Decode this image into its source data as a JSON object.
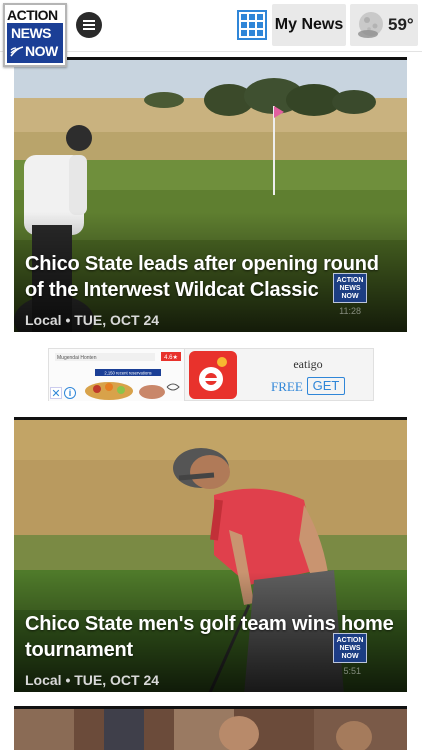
{
  "header": {
    "logo": {
      "line1": "ACTION",
      "line2": "NEWS",
      "line3": "NOW"
    },
    "menu_icon": "hamburger-menu-icon",
    "grid_icon": "grid-view-icon",
    "my_news_label": "My News",
    "weather": {
      "icon": "moon-cloud-icon",
      "temperature": "59°"
    }
  },
  "stories": [
    {
      "title": "Chico State leads after opening round of the Interwest Wildcat Classic",
      "meta": "Local • TUE, OCT 24",
      "bug": {
        "line1": "ACTION",
        "line2": "NEWS",
        "line3": "NOW"
      },
      "video_time": "11:28"
    },
    {
      "title": "Chico State men's golf team wins home tournament",
      "meta": "Local • TUE, OCT 24",
      "bug": {
        "line1": "ACTION",
        "line2": "NEWS",
        "line3": "NOW"
      },
      "video_time": "5:51"
    }
  ],
  "ad": {
    "headline": "Mugendai Honten",
    "price_badge": "4.6★",
    "reservations_text": "2,150 recent reservations",
    "brand": "eatigo",
    "free_label": "FREE",
    "get_label": "GET",
    "close_icon": "close-icon",
    "info_icon": "info-icon"
  },
  "colors": {
    "accent_blue": "#2f86d8",
    "logo_blue": "#1b3f96",
    "ad_red": "#e8322c"
  }
}
